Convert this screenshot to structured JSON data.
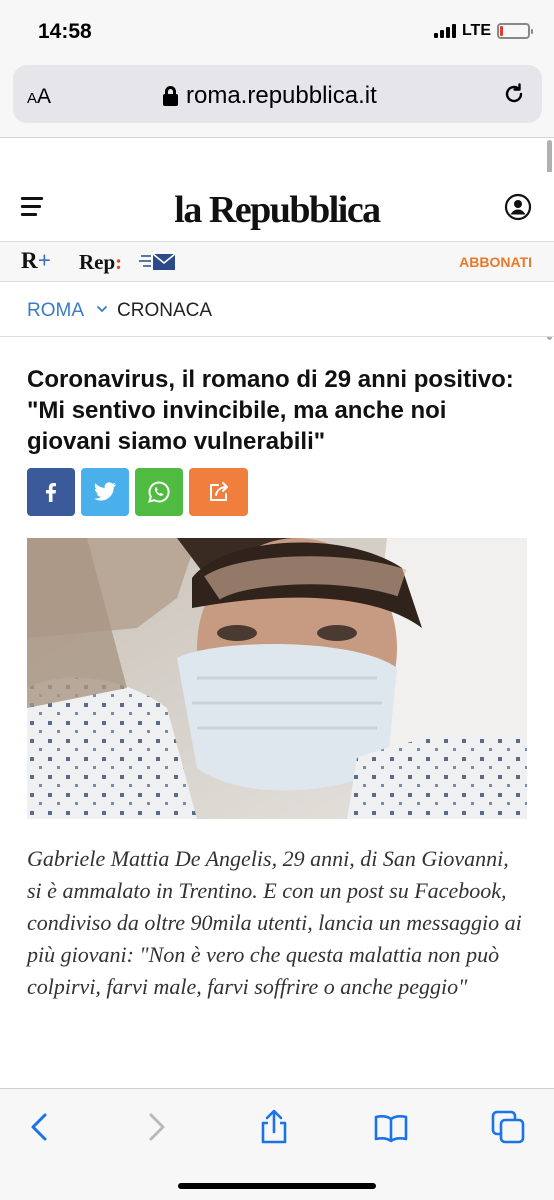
{
  "status_bar": {
    "time": "14:58",
    "network": "LTE",
    "battery_level": 0.12,
    "battery_color": "#e53b2f"
  },
  "browser": {
    "reader_button": "AA",
    "url": "roma.repubblica.it",
    "lock_icon": "lock-icon",
    "reload_icon": "reload-icon"
  },
  "site": {
    "logo": "la Repubblica",
    "menu_icon": "hamburger-menu-icon",
    "user_icon": "user-account-icon"
  },
  "subnav": {
    "rplus_letter": "R",
    "rplus_plus": "+",
    "rep_label": "Rep",
    "rep_colon": ":",
    "newsletter_icon": "envelope-icon",
    "subscribe_label": "ABBONATI",
    "subscribe_color": "#e8782a"
  },
  "breadcrumb": {
    "section": "ROMA",
    "subsection": "CRONACA",
    "link_color": "#3b7ac8"
  },
  "article": {
    "headline": "Coronavirus, il romano di 29 anni positivo: \"Mi sentivo invincibile, ma anche noi giovani siamo vulnerabili\"",
    "caption": "Gabriele Mattia De Angelis, 29 anni, di San Giovanni, si è ammalato in Trentino. E con un post su Facebook, condiviso da oltre 90mila utenti, lancia un messaggio ai più giovani: \"Non è vero che questa malattia non può colpirvi, farvi male, farvi soffrire o anche peggio\""
  },
  "share_buttons": [
    {
      "name": "facebook",
      "icon": "facebook-icon",
      "color": "#3b5a9a"
    },
    {
      "name": "twitter",
      "icon": "twitter-icon",
      "color": "#4ab0ec"
    },
    {
      "name": "whatsapp",
      "icon": "whatsapp-icon",
      "color": "#4fbb40"
    },
    {
      "name": "share",
      "icon": "share-icon",
      "color": "#f07f3e"
    }
  ],
  "toolbar": {
    "back_icon": "back-chevron-icon",
    "forward_icon": "forward-chevron-icon",
    "share_icon": "share-icon",
    "bookmarks_icon": "book-icon",
    "tabs_icon": "tabs-icon",
    "accent_color": "#1a73e8"
  }
}
